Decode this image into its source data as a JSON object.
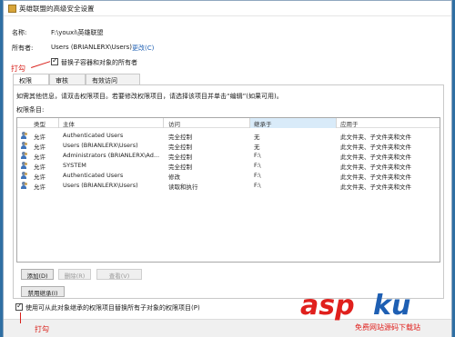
{
  "window": {
    "title": "英雄联盟的高级安全设置"
  },
  "props": {
    "name_label": "名称:",
    "name_value": "F:\\youxi\\英雄联盟",
    "owner_label": "所有者:",
    "owner_value": "Users (BRIANLERX\\Users)",
    "owner_change_link": "更改(C)",
    "replace_owner_checkbox_label": "替换子容器和对象的所有者"
  },
  "annotations": {
    "top": "打勾",
    "bottom": "打勾"
  },
  "tabs": [
    {
      "label": "权限"
    },
    {
      "label": "审核"
    },
    {
      "label": "有效访问"
    }
  ],
  "permissions": {
    "info_text": "如需其他信息，请双击权限项目。若要修改权限项目，请选择该项目并单击“编辑”(如果可用)。",
    "entries_label": "权限条目:",
    "columns": [
      "类型",
      "主体",
      "访问",
      "继承于",
      "应用于"
    ],
    "rows": [
      {
        "type": "允许",
        "principal": "Authenticated Users",
        "access": "完全控制",
        "inherited": "无",
        "applies": "此文件夹、子文件夹和文件"
      },
      {
        "type": "允许",
        "principal": "Users (BRIANLERX\\Users)",
        "access": "完全控制",
        "inherited": "无",
        "applies": "此文件夹、子文件夹和文件"
      },
      {
        "type": "允许",
        "principal": "Administrators (BRIANLERX\\Ad...",
        "access": "完全控制",
        "inherited": "F:\\",
        "applies": "此文件夹、子文件夹和文件"
      },
      {
        "type": "允许",
        "principal": "SYSTEM",
        "access": "完全控制",
        "inherited": "F:\\",
        "applies": "此文件夹、子文件夹和文件"
      },
      {
        "type": "允许",
        "principal": "Authenticated Users",
        "access": "修改",
        "inherited": "F:\\",
        "applies": "此文件夹、子文件夹和文件"
      },
      {
        "type": "允许",
        "principal": "Users (BRIANLERX\\Users)",
        "access": "读取和执行",
        "inherited": "F:\\",
        "applies": "此文件夹、子文件夹和文件"
      }
    ],
    "add_button": "添加(D)",
    "remove_button": "删除(R)",
    "view_button": "查看(V)",
    "disable_inheritance_button": "禁用继承(I)",
    "replace_child_checkbox_label": "使用可从此对象继承的权限项目替换所有子对象的权限项目(P)"
  },
  "watermark": {
    "brand_red": "asp",
    "brand_blue": "ku",
    "subtitle": "免费网站源码下载站"
  }
}
